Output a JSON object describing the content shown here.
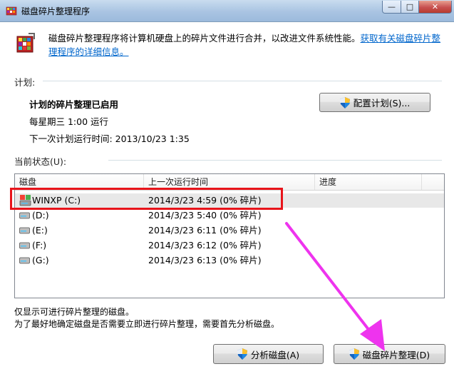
{
  "window": {
    "title": "磁盘碎片整理程序",
    "minimize_glyph": "—",
    "maximize_glyph": "□",
    "close_glyph": "✕"
  },
  "intro": {
    "text": "磁盘碎片整理程序将计算机硬盘上的碎片文件进行合并，以改进文件系统性能。",
    "link": "获取有关磁盘碎片整理程序的详细信息。"
  },
  "schedule": {
    "section_label": "计划:",
    "status": "计划的碎片整理已启用",
    "frequency": "每星期三  1:00 运行",
    "next_run": "下一次计划运行时间: 2013/10/23 1:35",
    "configure_button": "配置计划(S)..."
  },
  "current_status": {
    "section_label": "当前状态(U):",
    "columns": [
      "磁盘",
      "上一次运行时间",
      "进度"
    ],
    "rows": [
      {
        "disk": "WINXP (C:)",
        "last_run": "2014/3/23 4:59 (0% 碎片)",
        "progress": ""
      },
      {
        "disk": "(D:)",
        "last_run": "2014/3/23 5:40 (0% 碎片)",
        "progress": ""
      },
      {
        "disk": "(E:)",
        "last_run": "2014/3/23 6:11 (0% 碎片)",
        "progress": ""
      },
      {
        "disk": "(F:)",
        "last_run": "2014/3/23 6:12 (0% 碎片)",
        "progress": ""
      },
      {
        "disk": "(G:)",
        "last_run": "2014/3/23 6:13 (0% 碎片)",
        "progress": ""
      }
    ],
    "selected_index": 0
  },
  "notes": {
    "line1": "仅显示可进行碎片整理的磁盘。",
    "line2": "为了最好地确定磁盘是否需要立即进行碎片整理，需要首先分析磁盘。"
  },
  "buttons": {
    "analyze": "分析磁盘(A)",
    "defrag": "磁盘碎片整理(D)"
  },
  "colors": {
    "annotation_box": "#e8141b",
    "annotation_arrow": "#ee33ee",
    "link": "#0066cc"
  },
  "icons": {
    "app": "defrag-app-icon",
    "shield": "uac-shield-icon",
    "system_drive": "system-drive-icon",
    "drive": "hard-drive-icon"
  }
}
